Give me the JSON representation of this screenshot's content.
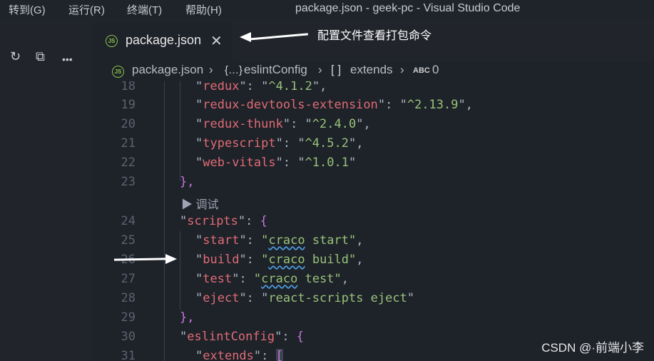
{
  "titlebar": {
    "menus": [
      "转到(G)",
      "运行(R)",
      "终端(T)",
      "帮助(H)"
    ],
    "window_title": "package.json - geek-pc - Visual Studio Code"
  },
  "activity": {
    "icons": [
      "refresh-icon",
      "collapse-all-icon",
      "more-icon"
    ],
    "glyphs": [
      "↻",
      "⧉",
      "•••"
    ]
  },
  "tab": {
    "icon_text": "JS",
    "label": "package.json",
    "close_glyph": "✕"
  },
  "annotations": {
    "tab_note": "配置文件查看打包命令"
  },
  "breadcrumb": {
    "file": "package.json",
    "sep": "›",
    "obj_icon": "{…}",
    "obj": "eslintConfig",
    "arr_icon": "[ ]",
    "arr": "extends",
    "str_icon": "ABC",
    "idx": "0"
  },
  "code": {
    "codelens": "▶ 调试",
    "lines": [
      {
        "n": "18",
        "key": "redux",
        "val": "^4.1.2"
      },
      {
        "n": "19",
        "key": "redux-devtools-extension",
        "val": "^2.13.9"
      },
      {
        "n": "20",
        "key": "redux-thunk",
        "val": "^2.4.0"
      },
      {
        "n": "21",
        "key": "typescript",
        "val": "^4.5.2"
      },
      {
        "n": "22",
        "key": "web-vitals",
        "val": "^1.0.1"
      },
      {
        "n": "23",
        "text": "},"
      },
      {
        "n": "24",
        "key": "scripts",
        "brace": "{"
      },
      {
        "n": "25",
        "key": "start",
        "val_word": "craco",
        "val_rest": " start"
      },
      {
        "n": "26",
        "key": "build",
        "val_word": "craco",
        "val_rest": " build"
      },
      {
        "n": "27",
        "key": "test",
        "val_word": "craco",
        "val_rest": " test"
      },
      {
        "n": "28",
        "key": "eject",
        "val": "react-scripts eject"
      },
      {
        "n": "29",
        "text": "},"
      },
      {
        "n": "30",
        "key": "eslintConfig",
        "brace": "{"
      },
      {
        "n": "31",
        "key": "extends",
        "brace": "["
      }
    ]
  },
  "watermark": "CSDN @·前端小李",
  "colors": {
    "key": "#e06c75",
    "string": "#98c379",
    "brace": "#c678dd",
    "line_number": "#5c6370",
    "background": "#1e2229"
  }
}
